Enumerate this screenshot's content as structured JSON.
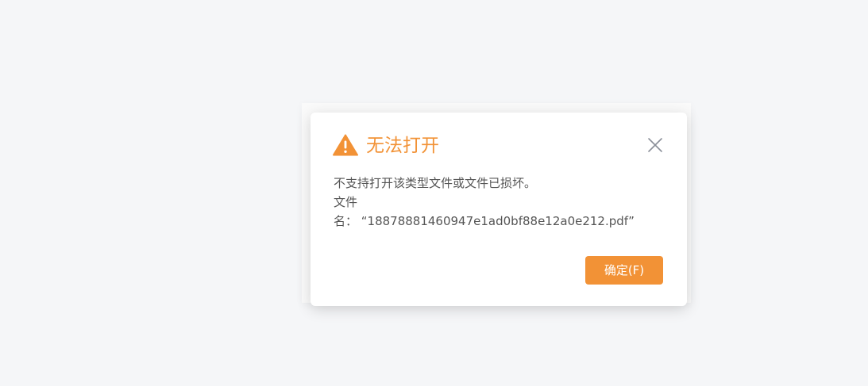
{
  "dialog": {
    "icon": "warning-triangle-icon",
    "title": "无法打开",
    "close_icon": "close-icon",
    "message_line1": "不支持打开该类型文件或文件已损坏。",
    "message_line2": "文件",
    "message_line3": "名：  “18878881460947e1ad0bf88e12a0e212.pdf”",
    "confirm_label": "确定(F)"
  },
  "colors": {
    "accent": "#f29236",
    "background": "#f5f6f8",
    "text": "#555555",
    "close_icon": "#8a8f99"
  }
}
